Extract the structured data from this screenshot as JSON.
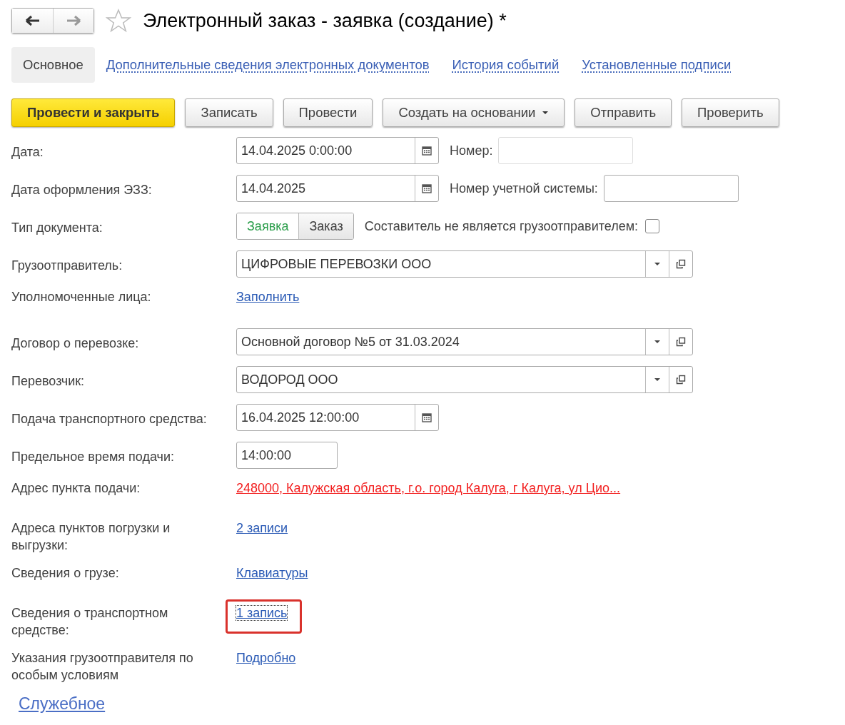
{
  "window": {
    "title": "Электронный заказ - заявка (создание) *",
    "favorite": false
  },
  "tabs": [
    {
      "label": "Основное",
      "selected": true
    },
    {
      "label": "Дополнительные сведения электронных документов",
      "selected": false
    },
    {
      "label": "История событий",
      "selected": false
    },
    {
      "label": "Установленные подписи",
      "selected": false
    }
  ],
  "toolbar": [
    {
      "label": "Провести и закрыть",
      "default": true,
      "dropdown": false
    },
    {
      "label": "Записать",
      "default": false,
      "dropdown": false
    },
    {
      "label": "Провести",
      "default": false,
      "dropdown": false
    },
    {
      "label": "Создать на основании",
      "default": false,
      "dropdown": true
    },
    {
      "label": "Отправить",
      "default": false,
      "dropdown": false
    },
    {
      "label": "Проверить",
      "default": false,
      "dropdown": false
    }
  ],
  "fields": [
    {
      "kind": "date",
      "label": "Дата:",
      "value": "14.04.2025  0:00:00",
      "side": {
        "label": "Номер:",
        "disabled": true
      }
    },
    {
      "kind": "date",
      "label": "Дата оформления ЭЗЗ:",
      "value": "14.04.2025",
      "side": {
        "label": "Номер учетной системы:",
        "disabled": false
      }
    },
    {
      "kind": "toggle",
      "label": "Тип документа:",
      "options": [
        {
          "label": "Заявка",
          "selected": true
        },
        {
          "label": "Заказ",
          "selected": false
        }
      ],
      "check": {
        "label": "Составитель не является грузоотправителем:",
        "checked": false
      }
    },
    {
      "kind": "ref",
      "label": "Грузоотправитель:",
      "value": "ЦИФРОВЫЕ ПЕРЕВОЗКИ ООО"
    },
    {
      "kind": "link",
      "label": "Уполномоченные лица:",
      "value": "Заполнить",
      "error": false,
      "highlighted": false
    },
    {
      "kind": "ref",
      "label": "Договор о перевозке:",
      "value": "Основной договор №5 от 31.03.2024"
    },
    {
      "kind": "ref",
      "label": "Перевозчик:",
      "value": "ВОДОРОД ООО"
    },
    {
      "kind": "date",
      "label": "Подача транспортного средства:",
      "value": "16.04.2025 12:00:00"
    },
    {
      "kind": "time",
      "label": "Предельное время подачи:",
      "value": "14:00:00"
    },
    {
      "kind": "link",
      "label": "Адрес пункта подачи:",
      "value": "248000, Калужская область, г.о. город Калуга, г Калуга, ул Цио...",
      "error": true,
      "highlighted": false
    },
    {
      "kind": "link",
      "label": "Адреса пунктов погрузки и выгрузки:",
      "value": "2 записи",
      "error": false,
      "highlighted": false
    },
    {
      "kind": "link",
      "label": "Сведения о грузе:",
      "value": "Клавиатуры",
      "error": false,
      "highlighted": false
    },
    {
      "kind": "link",
      "label": "Сведения о транспортном средстве:",
      "value": "1 запись",
      "error": false,
      "highlighted": true
    },
    {
      "kind": "link",
      "label": "Указания грузоотправителя по особым условиям",
      "value": "Подробно",
      "error": false,
      "highlighted": false
    }
  ],
  "footer_link": "Служебное"
}
